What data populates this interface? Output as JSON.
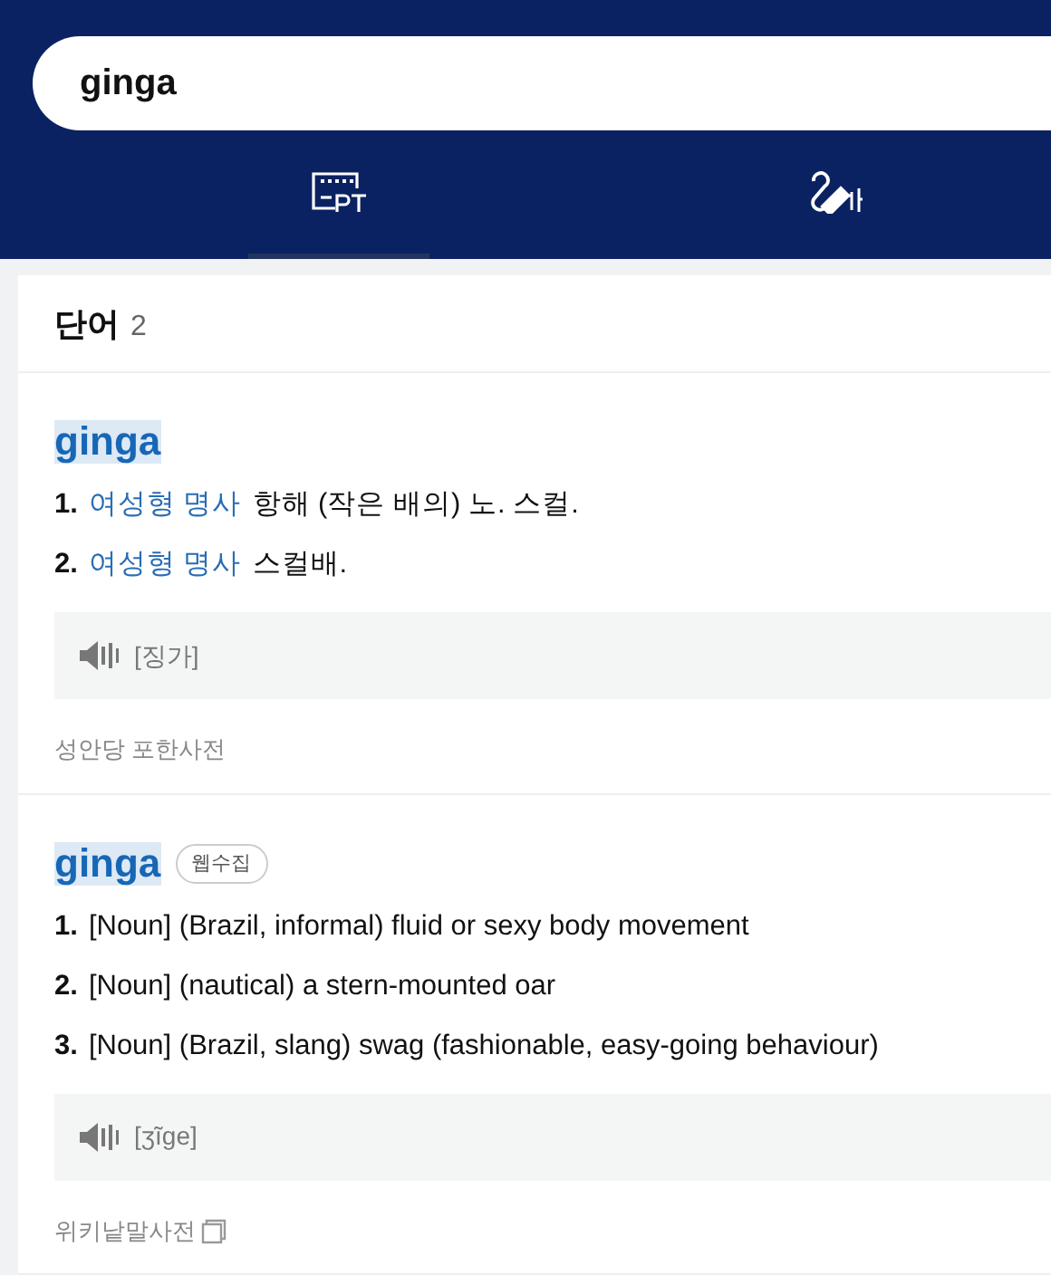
{
  "search": {
    "value": "ginga"
  },
  "tabs": [
    {
      "kind": "keyboard",
      "selected": true
    },
    {
      "kind": "handwriting",
      "selected": false
    }
  ],
  "section": {
    "title": "단어",
    "count": "2"
  },
  "entries": [
    {
      "headword": "ginga",
      "definitions": [
        {
          "number": "1.",
          "pos": "여성형 명사",
          "text": "항해 (작은 배의) 노. 스컬."
        },
        {
          "number": "2.",
          "pos": "여성형 명사",
          "text": "스컬배."
        }
      ],
      "pronunciation": "[징가]",
      "source": "성안당 포한사전",
      "source_link": false
    },
    {
      "headword": "ginga",
      "badge": "웹수집",
      "definitions": [
        {
          "number": "1.",
          "text": "[Noun] (Brazil, informal) fluid or sexy body movement"
        },
        {
          "number": "2.",
          "text": "[Noun] (nautical) a stern-mounted oar"
        },
        {
          "number": "3.",
          "text": "[Noun] (Brazil, slang) swag (fashionable, easy-going behaviour)"
        }
      ],
      "pronunciation": "[ʒĩge]",
      "source": "위키낱말사전",
      "source_link": true
    }
  ]
}
